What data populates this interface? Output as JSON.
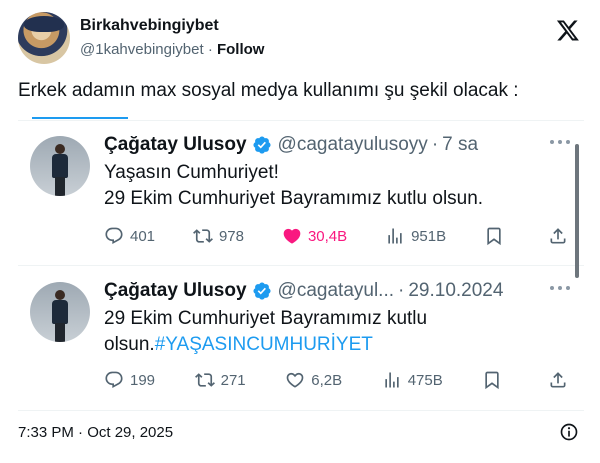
{
  "author": {
    "display_name": "Birkahvebingiybet",
    "handle": "@1kahvebingiybet",
    "separator": "·",
    "follow_label": "Follow"
  },
  "post": {
    "text": "Erkek adamın max sosyal medya kullanımı şu şekil olacak :",
    "timestamp": "7:33 PM · Oct 29, 2025"
  },
  "embedded_tweets": [
    {
      "name": "Çağatay Ulusoy",
      "handle": "@cagatayulusoyy",
      "separator": "·",
      "time": "7 sa",
      "lines": [
        "Yaşasın Cumhuriyet!",
        "29 Ekim Cumhuriyet Bayramımız kutlu olsun."
      ],
      "replies": "401",
      "retweets": "978",
      "likes": "30,4B",
      "views": "951B",
      "liked": true
    },
    {
      "name": "Çağatay Ulusoy",
      "handle": "@cagatayul...",
      "separator": "·",
      "time": "29.10.2024",
      "lines": [
        "29 Ekim Cumhuriyet Bayramımız kutlu",
        "olsun."
      ],
      "hashtag": "#YAŞASINCUMHURİYET",
      "replies": "199",
      "retweets": "271",
      "likes": "6,2B",
      "views": "475B",
      "liked": false
    }
  ],
  "icons": {
    "logo": "x-logo-icon",
    "verified": "verified-badge-icon",
    "reply": "reply-icon",
    "retweet": "retweet-icon",
    "like": "heart-icon",
    "views": "views-icon",
    "bookmark": "bookmark-icon",
    "share": "share-icon",
    "info": "info-icon",
    "more": "more-options-icon"
  },
  "colors": {
    "accent": "#1d9bf0",
    "like": "#f91880",
    "secondary_text": "#536471"
  }
}
